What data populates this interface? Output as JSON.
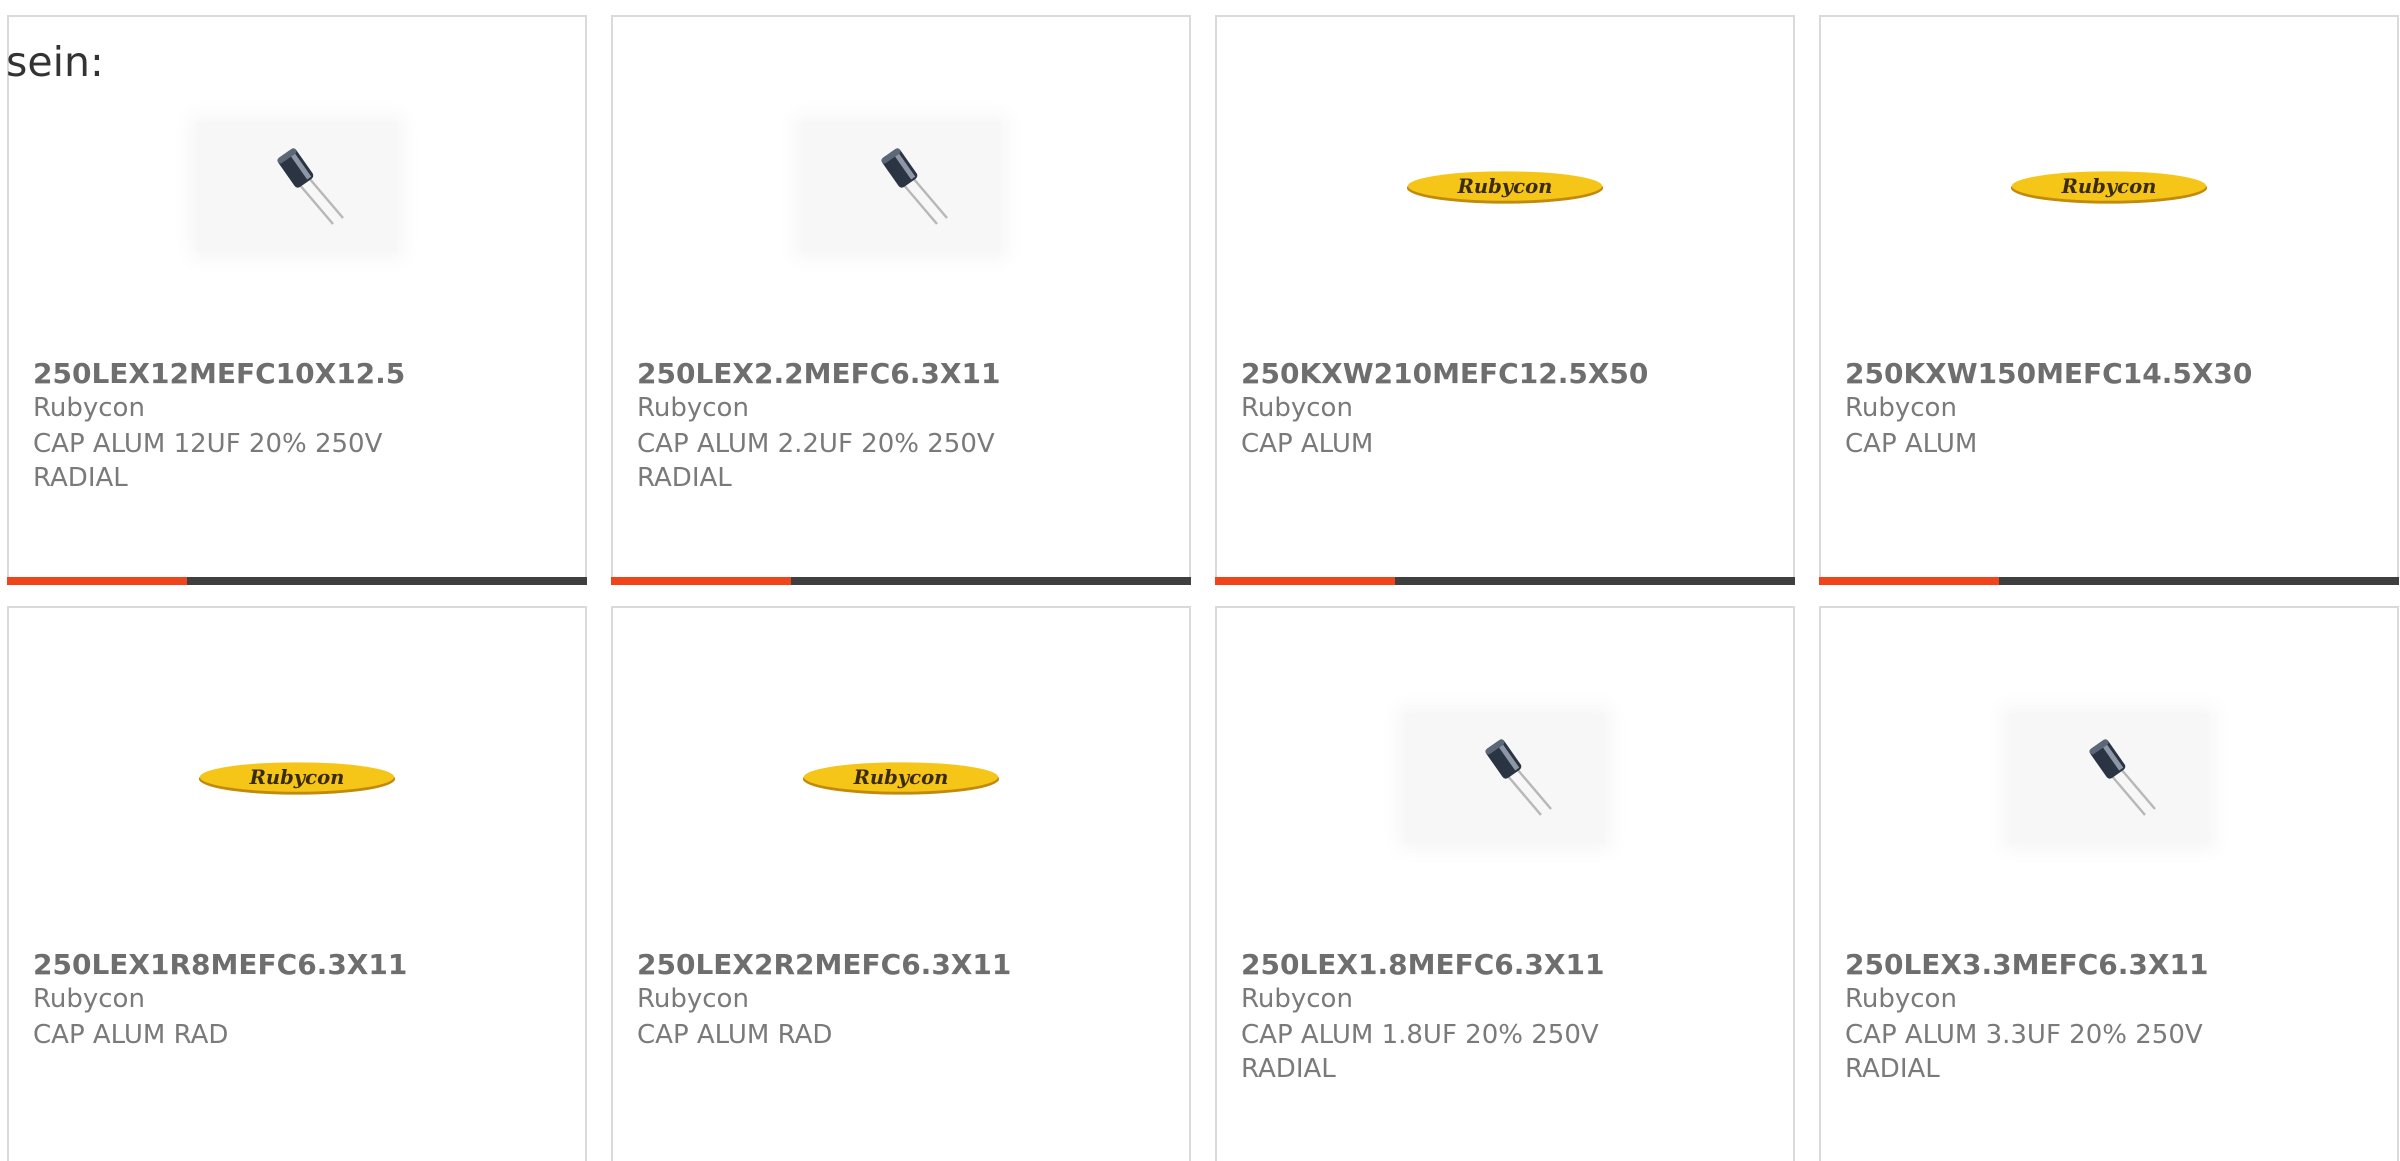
{
  "intro": {
    "text": "sein:"
  },
  "colors": {
    "card_border": "#dadada",
    "bar_dark": "#3f3f3f",
    "bar_accent": "#f0441a",
    "logo_yellow": "#f5c518",
    "text_gray": "#6e6e6e"
  },
  "products": [
    {
      "part_number": "250LEX12MEFC10X12.5",
      "manufacturer": "Rubycon",
      "description": "CAP ALUM 12UF 20% 250V RADIAL",
      "image": "capacitor-photo",
      "accent_fraction": 0.31
    },
    {
      "part_number": "250LEX2.2MEFC6.3X11",
      "manufacturer": "Rubycon",
      "description": "CAP ALUM 2.2UF 20% 250V RADIAL",
      "image": "capacitor-photo",
      "accent_fraction": 0.31
    },
    {
      "part_number": "250KXW210MEFC12.5X50",
      "manufacturer": "Rubycon",
      "description": "CAP ALUM",
      "image": "rubycon-logo",
      "logo_text": "Rubycon",
      "accent_fraction": 0.31
    },
    {
      "part_number": "250KXW150MEFC14.5X30",
      "manufacturer": "Rubycon",
      "description": "CAP ALUM",
      "image": "rubycon-logo",
      "logo_text": "Rubycon",
      "accent_fraction": 0.31
    },
    {
      "part_number": "250LEX1R8MEFC6.3X11",
      "manufacturer": "Rubycon",
      "description": "CAP ALUM RAD",
      "image": "rubycon-logo",
      "logo_text": "Rubycon"
    },
    {
      "part_number": "250LEX2R2MEFC6.3X11",
      "manufacturer": "Rubycon",
      "description": "CAP ALUM RAD",
      "image": "rubycon-logo",
      "logo_text": "Rubycon"
    },
    {
      "part_number": "250LEX1.8MEFC6.3X11",
      "manufacturer": "Rubycon",
      "description": "CAP ALUM 1.8UF 20% 250V RADIAL",
      "image": "capacitor-photo"
    },
    {
      "part_number": "250LEX3.3MEFC6.3X11",
      "manufacturer": "Rubycon",
      "description": "CAP ALUM 3.3UF 20% 250V RADIAL",
      "image": "capacitor-photo"
    }
  ]
}
